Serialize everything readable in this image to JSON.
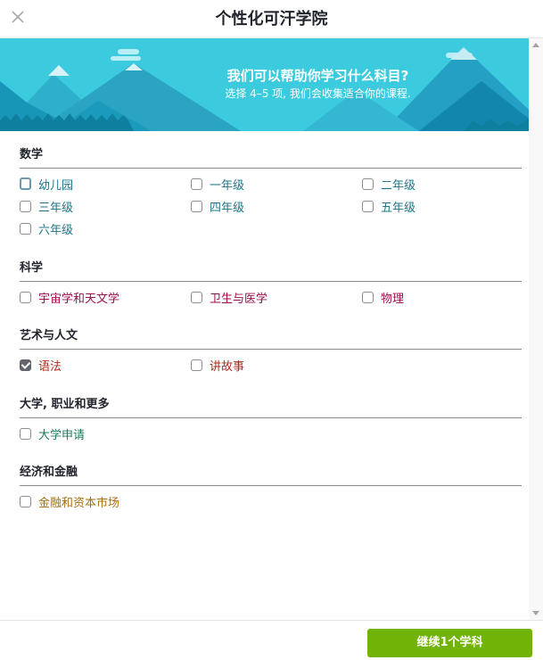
{
  "header": {
    "title": "个性化可汗学院",
    "close_icon": "close-icon"
  },
  "banner": {
    "title": "我们可以帮助你学习什么科目?",
    "subtitle": "选择 4–5 项, 我们会收集适合你的课程."
  },
  "sections": {
    "math": {
      "title": "数学",
      "color": "#1c758a",
      "options": [
        {
          "label": "幼儿园",
          "checked": false
        },
        {
          "label": "一年级",
          "checked": false
        },
        {
          "label": "二年级",
          "checked": false
        },
        {
          "label": "三年级",
          "checked": false
        },
        {
          "label": "四年级",
          "checked": false
        },
        {
          "label": "五年级",
          "checked": false
        },
        {
          "label": "六年级",
          "checked": false
        }
      ]
    },
    "science": {
      "title": "科学",
      "color": "#9c0e4d",
      "options": [
        {
          "label": "宇宙学和天文学",
          "checked": false
        },
        {
          "label": "卫生与医学",
          "checked": false
        },
        {
          "label": "物理",
          "checked": false
        }
      ]
    },
    "arts": {
      "title": "艺术与人文",
      "color": "#b22a1a",
      "options": [
        {
          "label": "语法",
          "checked": true
        },
        {
          "label": "讲故事",
          "checked": false
        }
      ]
    },
    "college": {
      "title": "大学, 职业和更多",
      "color": "#1a7b5d",
      "options": [
        {
          "label": "大学申请",
          "checked": false
        }
      ]
    },
    "economics": {
      "title": "经济和金融",
      "color": "#a56e10",
      "options": [
        {
          "label": "金融和资本市场",
          "checked": false
        }
      ]
    }
  },
  "footer": {
    "continue_label": "继续1个学科",
    "button_color": "#71b307"
  }
}
